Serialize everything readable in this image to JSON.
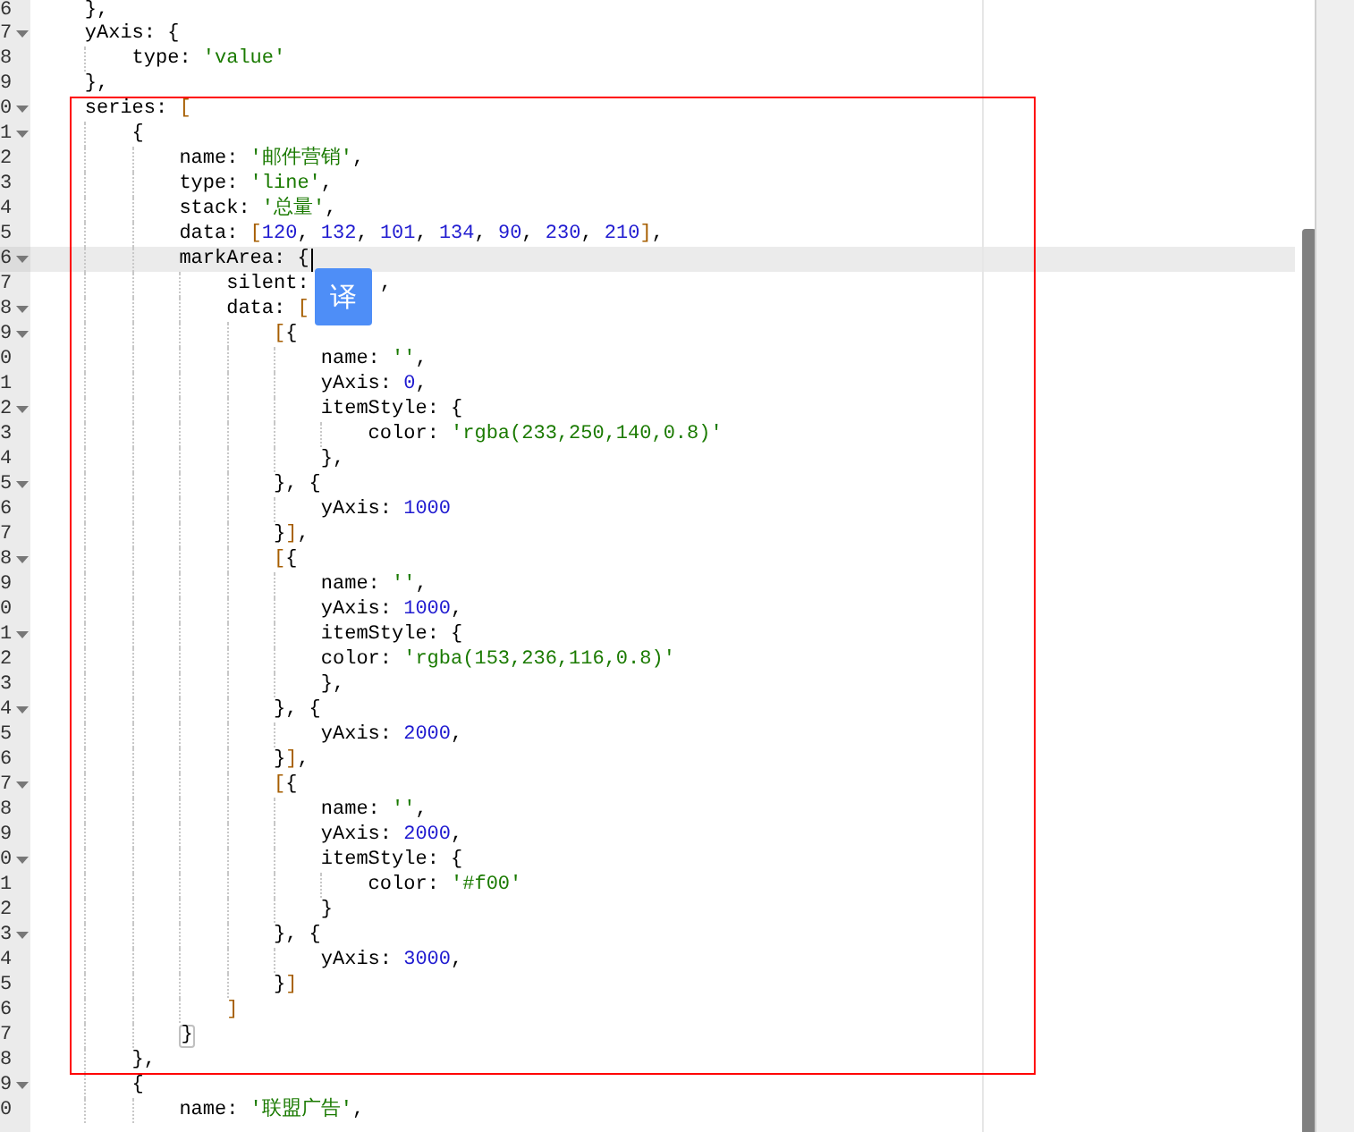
{
  "editor": {
    "lines": [
      {
        "number": "6",
        "text": "    },",
        "fold": false
      },
      {
        "number": "7",
        "text": "    yAxis: {",
        "fold": true
      },
      {
        "number": "8",
        "text": "        type: 'value'",
        "fold": false
      },
      {
        "number": "9",
        "text": "    },",
        "fold": false
      },
      {
        "number": "0",
        "text": "    series: [",
        "fold": true
      },
      {
        "number": "1",
        "text": "        {",
        "fold": true
      },
      {
        "number": "2",
        "text": "            name: '邮件营销',",
        "fold": false
      },
      {
        "number": "3",
        "text": "            type: 'line',",
        "fold": false
      },
      {
        "number": "4",
        "text": "            stack: '总量',",
        "fold": false
      },
      {
        "number": "5",
        "text": "            data: [120, 132, 101, 134, 90, 230, 210],",
        "fold": false
      },
      {
        "number": "6",
        "text": "            markArea: {",
        "fold": true,
        "active": true,
        "cursor": true
      },
      {
        "number": "7",
        "text": "                silent:      ,",
        "fold": false
      },
      {
        "number": "8",
        "text": "                data: [",
        "fold": true
      },
      {
        "number": "9",
        "text": "                    [{",
        "fold": true
      },
      {
        "number": "0",
        "text": "                        name: '',",
        "fold": false
      },
      {
        "number": "1",
        "text": "                        yAxis: 0,",
        "fold": false
      },
      {
        "number": "2",
        "text": "                        itemStyle: {",
        "fold": true
      },
      {
        "number": "3",
        "text": "                            color: 'rgba(233,250,140,0.8)'",
        "fold": false
      },
      {
        "number": "4",
        "text": "                        },",
        "fold": false
      },
      {
        "number": "5",
        "text": "                    }, {",
        "fold": true
      },
      {
        "number": "6",
        "text": "                        yAxis: 1000",
        "fold": false
      },
      {
        "number": "7",
        "text": "                    }],",
        "fold": false
      },
      {
        "number": "8",
        "text": "                    [{",
        "fold": true
      },
      {
        "number": "9",
        "text": "                        name: '',",
        "fold": false
      },
      {
        "number": "0",
        "text": "                        yAxis: 1000,",
        "fold": false
      },
      {
        "number": "1",
        "text": "                        itemStyle: {",
        "fold": true
      },
      {
        "number": "2",
        "text": "                        color: 'rgba(153,236,116,0.8)'",
        "fold": false
      },
      {
        "number": "3",
        "text": "                        },",
        "fold": false
      },
      {
        "number": "4",
        "text": "                    }, {",
        "fold": true
      },
      {
        "number": "5",
        "text": "                        yAxis: 2000,",
        "fold": false
      },
      {
        "number": "6",
        "text": "                    }],",
        "fold": false
      },
      {
        "number": "7",
        "text": "                    [{",
        "fold": true
      },
      {
        "number": "8",
        "text": "                        name: '',",
        "fold": false
      },
      {
        "number": "9",
        "text": "                        yAxis: 2000,",
        "fold": false
      },
      {
        "number": "0",
        "text": "                        itemStyle: {",
        "fold": true
      },
      {
        "number": "1",
        "text": "                            color: '#f00'",
        "fold": false
      },
      {
        "number": "2",
        "text": "                        }",
        "fold": false
      },
      {
        "number": "3",
        "text": "                    }, {",
        "fold": true
      },
      {
        "number": "4",
        "text": "                        yAxis: 3000,",
        "fold": false
      },
      {
        "number": "5",
        "text": "                    }]",
        "fold": false
      },
      {
        "number": "6",
        "text": "                ]",
        "fold": false
      },
      {
        "number": "7",
        "text": "            }",
        "fold": false,
        "bracket_match": true
      },
      {
        "number": "8",
        "text": "        },",
        "fold": false
      },
      {
        "number": "9",
        "text": "        {",
        "fold": true
      },
      {
        "number": "0",
        "text": "            name: '联盟广告',",
        "fold": false
      }
    ]
  },
  "translate_button": {
    "label": "译"
  }
}
